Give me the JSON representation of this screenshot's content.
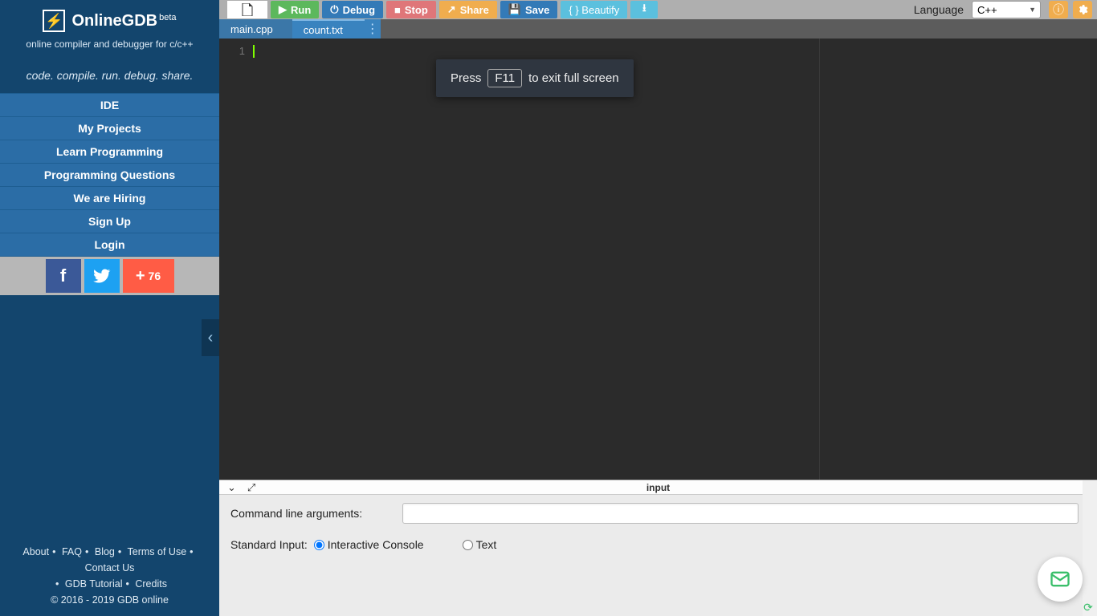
{
  "brand": {
    "name": "OnlineGDB",
    "beta": "beta",
    "subtitle": "online compiler and debugger for c/c++",
    "tagline": "code. compile. run. debug. share."
  },
  "nav": {
    "items": [
      "IDE",
      "My Projects",
      "Learn Programming",
      "Programming Questions",
      "We are Hiring",
      "Sign Up",
      "Login"
    ]
  },
  "social": {
    "share_count": "76"
  },
  "footer": {
    "links": [
      "About",
      "FAQ",
      "Blog",
      "Terms of Use",
      "Contact Us",
      "GDB Tutorial",
      "Credits"
    ],
    "copyright": "© 2016 - 2019 GDB online"
  },
  "toolbar": {
    "run": "Run",
    "debug": "Debug",
    "stop": "Stop",
    "share": "Share",
    "save": "Save",
    "beautify": "{ } Beautify",
    "language_label": "Language",
    "language_value": "C++"
  },
  "tabs": {
    "items": [
      "main.cpp",
      "count.txt"
    ],
    "active_index": 1
  },
  "editor": {
    "line_number": "1"
  },
  "fullscreen_toast": {
    "prefix": "Press",
    "key": "F11",
    "suffix": "to exit full screen"
  },
  "bottom": {
    "title": "input",
    "cmd_label": "Command line arguments:",
    "cmd_value": "",
    "stdin_label": "Standard Input:",
    "opt_interactive": "Interactive Console",
    "opt_text": "Text",
    "stdin_selected": "interactive"
  }
}
